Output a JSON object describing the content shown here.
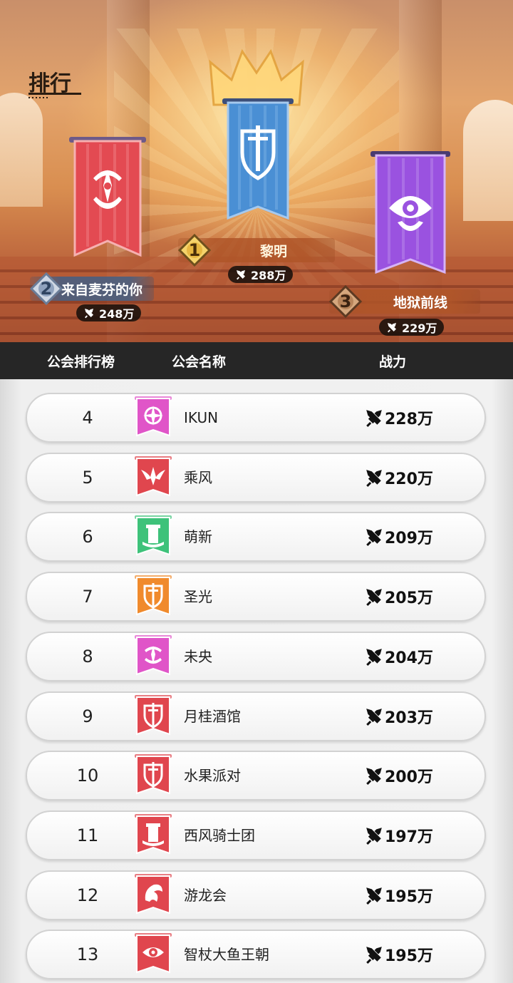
{
  "page": {
    "title": "排行"
  },
  "podium": {
    "first": {
      "medal": "1",
      "name": "黎明",
      "power": "288万",
      "banner_color": "#4a8fd4",
      "emblem": "sword-shield-icon"
    },
    "second": {
      "medal": "2",
      "name": "来自麦芬的你",
      "power": "248万",
      "banner_color": "#e34a52",
      "emblem": "star-crest-icon"
    },
    "third": {
      "medal": "3",
      "name": "地狱前线",
      "power": "229万",
      "banner_color": "#9a52e0",
      "emblem": "eye-crest-icon"
    }
  },
  "table": {
    "col_rank": "公会排行榜",
    "col_name": "公会名称",
    "col_power": "战力"
  },
  "rows": [
    {
      "rank": "4",
      "name": "IKUN",
      "power": "228万",
      "banner_color": "#e055c8",
      "emblem": "compass-icon"
    },
    {
      "rank": "5",
      "name": "乘风",
      "power": "220万",
      "banner_color": "#e0464e",
      "emblem": "winged-crest-icon"
    },
    {
      "rank": "6",
      "name": "萌新",
      "power": "209万",
      "banner_color": "#3ec27a",
      "emblem": "tower-icon"
    },
    {
      "rank": "7",
      "name": "圣光",
      "power": "205万",
      "banner_color": "#f08a2c",
      "emblem": "sword-shield-icon"
    },
    {
      "rank": "8",
      "name": "未央",
      "power": "204万",
      "banner_color": "#e055c8",
      "emblem": "star-crest-icon"
    },
    {
      "rank": "9",
      "name": "月桂酒馆",
      "power": "203万",
      "banner_color": "#e0464e",
      "emblem": "sword-shield-icon"
    },
    {
      "rank": "10",
      "name": "水果派对",
      "power": "200万",
      "banner_color": "#e0464e",
      "emblem": "sword-shield-icon"
    },
    {
      "rank": "11",
      "name": "西风骑士团",
      "power": "197万",
      "banner_color": "#e0464e",
      "emblem": "tower-icon"
    },
    {
      "rank": "12",
      "name": "游龙会",
      "power": "195万",
      "banner_color": "#e0464e",
      "emblem": "dragon-icon"
    },
    {
      "rank": "13",
      "name": "智杖大鱼王朝",
      "power": "195万",
      "banner_color": "#e0464e",
      "emblem": "eye-crest-icon"
    }
  ],
  "icons": {
    "power": "crossed-swords-icon"
  }
}
